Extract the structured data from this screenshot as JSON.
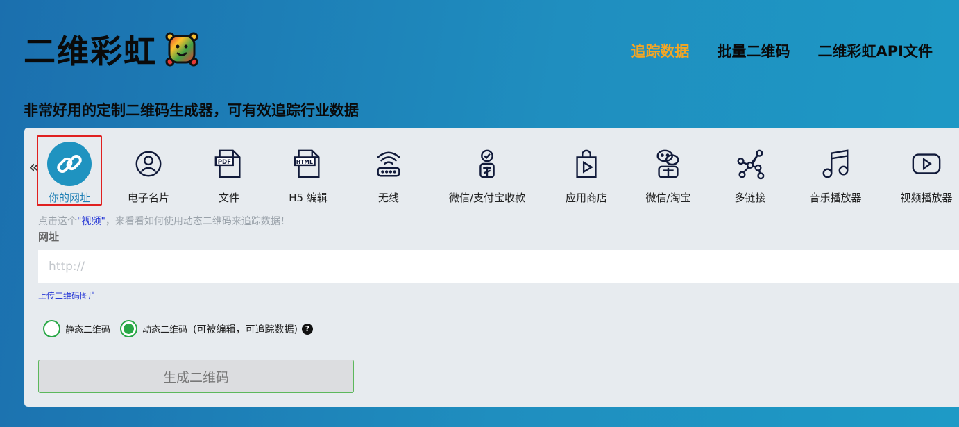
{
  "logo": {
    "text": "二维彩虹"
  },
  "nav": {
    "items": [
      {
        "label": "追踪数据",
        "active": true
      },
      {
        "label": "批量二维码",
        "active": false
      },
      {
        "label": "二维彩虹API文件",
        "active": false
      }
    ]
  },
  "tagline": "非常好用的定制二维码生成器，可有效追踪行业数据",
  "types": {
    "items": [
      {
        "label": "你的网址",
        "icon": "link-icon",
        "selected": true
      },
      {
        "label": "电子名片",
        "icon": "user-card-icon"
      },
      {
        "label": "文件",
        "icon": "pdf-file-icon"
      },
      {
        "label": "H5 编辑",
        "icon": "html-file-icon"
      },
      {
        "label": "无线",
        "icon": "wifi-router-icon"
      },
      {
        "label": "微信/支付宝收款",
        "icon": "payment-icon"
      },
      {
        "label": "应用商店",
        "icon": "app-store-bag-icon"
      },
      {
        "label": "微信/淘宝",
        "icon": "wechat-taobao-icon"
      },
      {
        "label": "多链接",
        "icon": "multi-link-icon"
      },
      {
        "label": "音乐播放器",
        "icon": "music-note-icon"
      },
      {
        "label": "视频播放器",
        "icon": "video-play-icon"
      }
    ]
  },
  "hint": {
    "prefix": "点击这个",
    "link": "\"视频\"",
    "suffix": "，来看看如何使用动态二维码来追踪数据！"
  },
  "url_field": {
    "label": "网址",
    "placeholder": "http://",
    "value": ""
  },
  "upload_link": "上传二维码图片",
  "qr_mode": {
    "static_label": "静态二维码",
    "dynamic_label": "动态二维码",
    "dynamic_note": "(可被编辑，可追踪数据)",
    "selected": "dynamic"
  },
  "generate_button": "生成二维码",
  "colors": {
    "accent": "#f5a623",
    "selected": "#1f93c0",
    "radio": "#28a745"
  }
}
